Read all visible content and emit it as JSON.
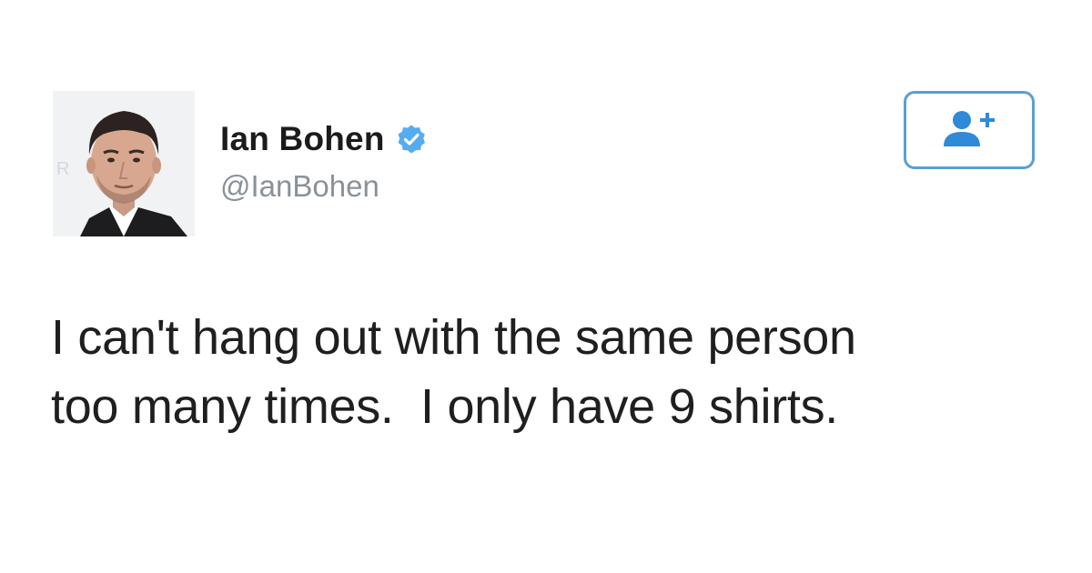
{
  "tweet": {
    "author": {
      "display_name": "Ian Bohen",
      "handle": "@IanBohen",
      "verified": true,
      "avatar_icon": "profile-photo"
    },
    "follow_button": {
      "icon": "add-user-icon"
    },
    "text": "I can't hang out with the same person\ntoo many times.  I only have 9 shirts."
  },
  "colors": {
    "accent": "#55acee",
    "button_border": "#5a9fd6",
    "handle": "#8a9299",
    "text": "#1f1f1f"
  }
}
